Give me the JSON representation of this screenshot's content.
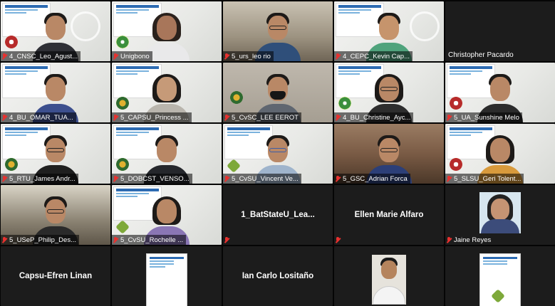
{
  "participants": [
    {
      "name": "4_CNSC_Leo_Agust...",
      "kind": "video"
    },
    {
      "name": "Unigbono",
      "kind": "video"
    },
    {
      "name": "5_urs_leo rio",
      "kind": "outdoor"
    },
    {
      "name": "4_CEPC_Kevin Cap...",
      "kind": "video"
    },
    {
      "name": "Christopher Pacardo",
      "kind": "dark-label"
    },
    {
      "name": "4_BU_OMAR_TUA...",
      "kind": "video"
    },
    {
      "name": "5_CAPSU_Princess ...",
      "kind": "video"
    },
    {
      "name": "5_CvSC_LEE EEROT",
      "kind": "wall"
    },
    {
      "name": "4_BU_Christine_Ayc...",
      "kind": "video"
    },
    {
      "name": "5_UA_Sunshine Melo",
      "kind": "video"
    },
    {
      "name": "5_RTU_James Andr...",
      "kind": "video"
    },
    {
      "name": "5_DOBCST_VENSO...",
      "kind": "video"
    },
    {
      "name": "5_CvSU_Vincent Ve...",
      "kind": "video"
    },
    {
      "name": "5_GSC_Adrian Forca",
      "kind": "room"
    },
    {
      "name": "5_SLSU_Geri Tolent...",
      "kind": "video"
    },
    {
      "name": "5_USeP_Philip_Des...",
      "kind": "outdoor"
    },
    {
      "name": "5_CvSU_Rochelle ...",
      "kind": "video"
    },
    {
      "name": "1_BatStateU_Lea...",
      "kind": "dark-center"
    },
    {
      "name": "Ellen Marie Alfaro",
      "kind": "dark-center"
    },
    {
      "name": "Jaine Reyes",
      "kind": "avatar"
    },
    {
      "name": "Capsu-Efren Linan",
      "kind": "dark-center"
    },
    {
      "name": "",
      "kind": "mini-slide"
    },
    {
      "name": "Ian Carlo Lositaño",
      "kind": "dark-center"
    },
    {
      "name": "",
      "kind": "mini-photo"
    },
    {
      "name": "",
      "kind": "mini-slide"
    }
  ],
  "colors": {
    "muted_mic": "#e8312f",
    "background": "#050505"
  }
}
